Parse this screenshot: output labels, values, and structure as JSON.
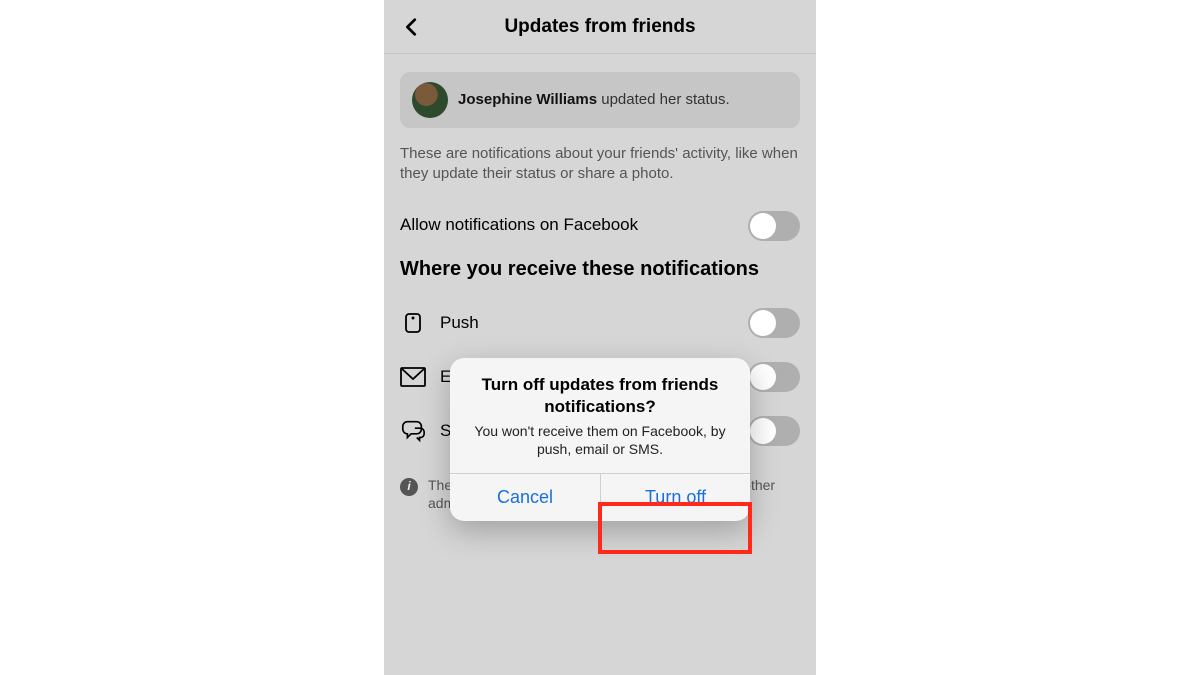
{
  "header": {
    "title": "Updates from friends"
  },
  "example": {
    "name": "Josephine Williams",
    "suffix": " updated her status."
  },
  "description": "These are notifications about your friends' activity, like when they update their status or share a photo.",
  "allow_row": {
    "label": "Allow notifications on Facebook"
  },
  "section_heading": "Where you receive these notifications",
  "channels": [
    {
      "label": "Push"
    },
    {
      "label": "Email"
    },
    {
      "label": "SMS"
    }
  ],
  "footer_note": "These settings will not impact the notifications that other admins receive.",
  "dialog": {
    "title": "Turn off updates from friends notifications?",
    "message": "You won't receive them on Facebook, by push, email or SMS.",
    "cancel": "Cancel",
    "confirm": "Turn off"
  }
}
